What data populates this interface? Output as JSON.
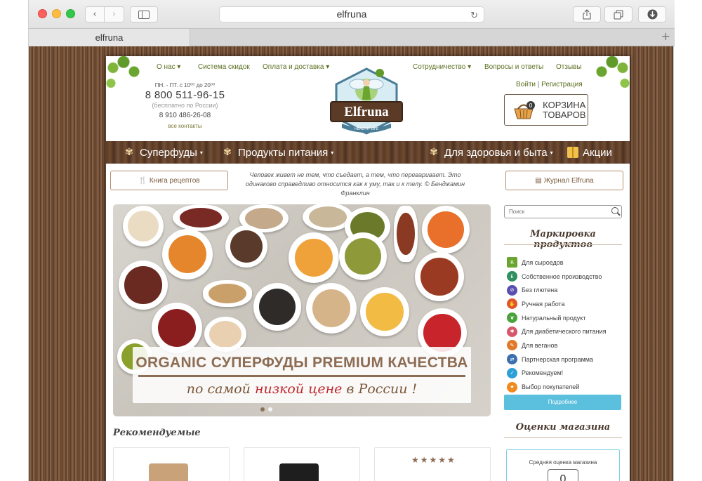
{
  "browser": {
    "url_title": "elfruna",
    "tab_title": "elfruna",
    "new_tab": "+"
  },
  "topnav": [
    {
      "label": "О нас",
      "caret": "▾"
    },
    {
      "label": "Система скидок"
    },
    {
      "label": "Оплата и доставка",
      "caret": "▾"
    },
    {
      "label": "Сотрудничество",
      "caret": "▾"
    },
    {
      "label": "Вопросы и ответы"
    },
    {
      "label": "Отзывы"
    }
  ],
  "contacts": {
    "hours": "ПН. - ПТ. с 10⁰⁰ до 20⁰⁰",
    "phone_main": "8 800 511-96-15",
    "phone_main_note": "(бесплатно по России)",
    "phone_second": "8 910 486-26-08",
    "all_contacts": "все контакты"
  },
  "logo": {
    "name": "Elfruna",
    "tagline": "HEALTHY LIFE"
  },
  "auth": {
    "login": "Войти",
    "separator": "|",
    "register": "Регистрация"
  },
  "cart": {
    "line1": "КОРЗИНА",
    "line2": "ТОВАРОВ",
    "count": "0"
  },
  "main_menu": [
    {
      "label": "Суперфуды",
      "icon": "wheat-icon",
      "caret": "▾"
    },
    {
      "label": "Продукты питания",
      "icon": "wheat-icon",
      "caret": "▾"
    },
    {
      "label": "Для здоровья и быта",
      "icon": "wheat-icon",
      "caret": "▾"
    },
    {
      "label": "Акции",
      "icon": "gift-icon"
    }
  ],
  "buttons": {
    "recipes": "Книга рецептов",
    "journal": "Журнал Elfruna"
  },
  "quote": "Человек живет не тем, что съедает, а тем, что переваривает. Это одинаково справедливо относится как к уму, так и к телу. © Бенджамин Франклин",
  "banner": {
    "line1": "ORGANIC СУПЕРФУДЫ PREMIUM КАЧЕСТВА",
    "line2_pre": "по самой ",
    "line2_red": "низкой цене",
    "line2_post": " в России !"
  },
  "recommended": {
    "title": "Рекомендуемые",
    "stars": "★★★★★"
  },
  "search": {
    "placeholder": "Поиск"
  },
  "marking": {
    "title": "Маркировка продуктов",
    "items": [
      {
        "label": "Для сыроедов",
        "icon": "raw-food-icon",
        "color": "#6aa52f"
      },
      {
        "label": "Собственное производство",
        "icon": "own-production-icon",
        "color": "#2f8f5f"
      },
      {
        "label": "Без глютена",
        "icon": "gluten-free-icon",
        "color": "#5a4fb0"
      },
      {
        "label": "Ручная работа",
        "icon": "handmade-icon",
        "color": "#e0562a"
      },
      {
        "label": "Натуральный продукт",
        "icon": "natural-product-icon",
        "color": "#4aa33a"
      },
      {
        "label": "Для диабетического питания",
        "icon": "diabetic-icon",
        "color": "#d8566b"
      },
      {
        "label": "Для веганов",
        "icon": "vegan-icon",
        "color": "#e07a2a"
      },
      {
        "label": "Партнерская программа",
        "icon": "partner-program-icon",
        "color": "#3a6fb0"
      },
      {
        "label": "Рекомендуем!",
        "icon": "recommended-icon",
        "color": "#2f9fd8"
      },
      {
        "label": "Выбор покупателей",
        "icon": "buyers-choice-icon",
        "color": "#f08a1c"
      }
    ],
    "more": "Подробнее"
  },
  "rating": {
    "title": "Оценки магазина",
    "label": "Средняя оценка магазина",
    "value": "0"
  },
  "colors": {
    "nav_green": "#5a6e1f",
    "brown": "#7a5a3c",
    "button_blue": "#5bbfde",
    "banner_red": "#c0262c"
  }
}
